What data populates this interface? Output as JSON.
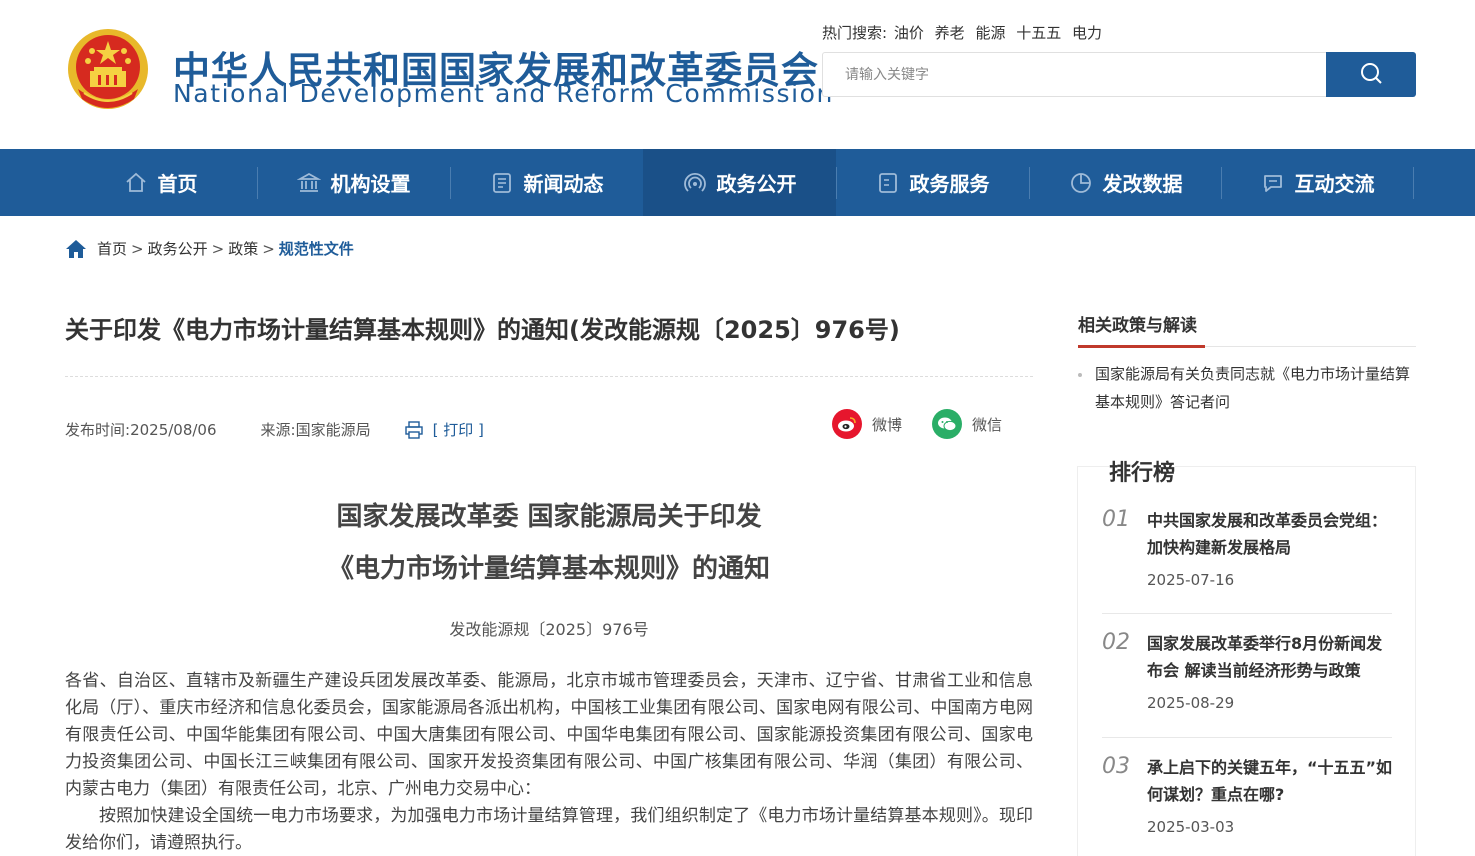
{
  "header": {
    "title_cn": "中华人民共和国国家发展和改革委员会",
    "title_en": "National Development and Reform Commission",
    "emblem_icon": "national-emblem-icon"
  },
  "search": {
    "hot_label": "热门搜索:",
    "hot_terms": [
      "油价",
      "养老",
      "能源",
      "十五五",
      "电力"
    ],
    "placeholder": "请输入关键字"
  },
  "nav": {
    "items": [
      {
        "label": "首页",
        "icon": "home-icon"
      },
      {
        "label": "机构设置",
        "icon": "institution-icon"
      },
      {
        "label": "新闻动态",
        "icon": "news-icon"
      },
      {
        "label": "政务公开",
        "icon": "broadcast-icon",
        "active": true
      },
      {
        "label": "政务服务",
        "icon": "service-icon"
      },
      {
        "label": "发改数据",
        "icon": "pie-chart-icon"
      },
      {
        "label": "互动交流",
        "icon": "chat-icon"
      }
    ]
  },
  "breadcrumb": {
    "items": [
      "首页",
      "政务公开",
      "政策"
    ],
    "separator": ">",
    "current": "规范性文件"
  },
  "article": {
    "title": "关于印发《电力市场计量结算基本规则》的通知(发改能源规〔2025〕976号)",
    "publish_label": "发布时间:",
    "publish_date": "2025/08/06",
    "source_label": "来源:",
    "source": "国家能源局",
    "print_label": "[ 打印 ]",
    "share": {
      "weibo": "微博",
      "wechat": "微信"
    },
    "heading_line1": "国家发展改革委 国家能源局关于印发",
    "heading_line2": "《电力市场计量结算基本规则》的通知",
    "doc_number": "发改能源规〔2025〕976号",
    "paragraph1": "各省、自治区、直辖市及新疆生产建设兵团发展改革委、能源局，北京市城市管理委员会，天津市、辽宁省、甘肃省工业和信息化局（厅）、重庆市经济和信息化委员会，国家能源局各派出机构，中国核工业集团有限公司、国家电网有限公司、中国南方电网有限责任公司、中国华能集团有限公司、中国大唐集团有限公司、中国华电集团有限公司、国家能源投资集团有限公司、国家电力投资集团公司、中国长江三峡集团有限公司、国家开发投资集团有限公司、中国广核集团有限公司、华润（集团）有限公司、内蒙古电力（集团）有限责任公司，北京、广州电力交易中心：",
    "paragraph2": "按照加快建设全国统一电力市场要求，为加强电力市场计量结算管理，我们组织制定了《电力市场计量结算基本规则》。现印发给你们，请遵照执行。"
  },
  "sidebar": {
    "related_title": "相关政策与解读",
    "related_items": [
      "国家能源局有关负责同志就《电力市场计量结算基本规则》答记者问"
    ],
    "rank_title": "排行榜",
    "rank_items": [
      {
        "num": "01",
        "title": "中共国家发展和改革委员会党组：加快构建新发展格局",
        "date": "2025-07-16"
      },
      {
        "num": "02",
        "title": "国家发展改革委举行8月份新闻发布会 解读当前经济形势与政策",
        "date": "2025-08-29"
      },
      {
        "num": "03",
        "title": "承上启下的关键五年，“十五五”如何谋划？重点在哪?",
        "date": "2025-03-03"
      }
    ]
  },
  "colors": {
    "brand_blue": "#1f5c99",
    "accent_red": "#c0392b"
  }
}
